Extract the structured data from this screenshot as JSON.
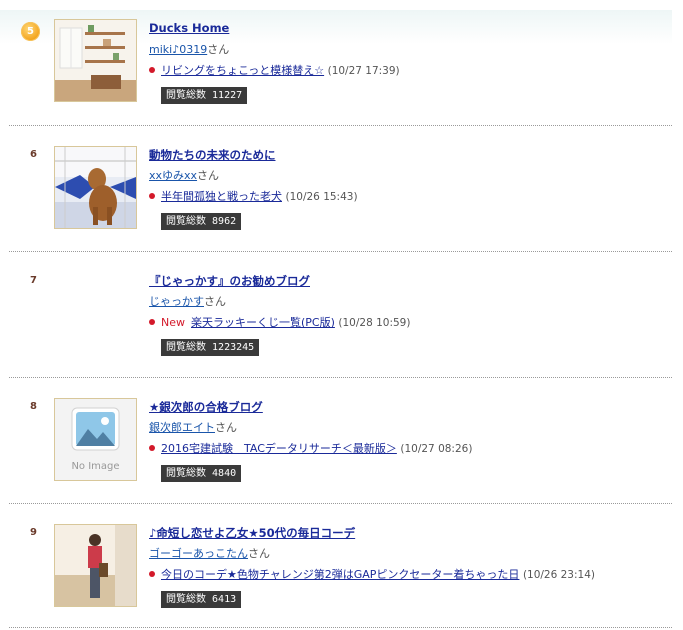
{
  "views_label": "閲覧総数",
  "entries": [
    {
      "rank": "5",
      "blog_title": "Ducks Home",
      "user": "miki♪0319",
      "san": "さん",
      "new_label": "",
      "post_title": "リビングをちょこっと模様替え☆",
      "date": "(10/27 17:39)",
      "views": "11227",
      "thumb": "room-photo"
    },
    {
      "rank": "6",
      "blog_title": "動物たちの未来のために",
      "user": "xxゆみxx",
      "san": "さん",
      "new_label": "",
      "post_title": "半年間孤独と戦った老犬",
      "date": "(10/26 15:43)",
      "views": "8962",
      "thumb": "dog-photo"
    },
    {
      "rank": "7",
      "blog_title": "『じゃっかす』のお勧めブログ",
      "user": "じゃっかす",
      "san": "さん",
      "new_label": "New",
      "post_title": "楽天ラッキーくじ一覧(PC版)",
      "date": "(10/28 10:59)",
      "views": "1223245",
      "thumb": ""
    },
    {
      "rank": "8",
      "blog_title": "★銀次郎の合格ブログ",
      "user": "銀次郎エイト",
      "san": "さん",
      "new_label": "",
      "post_title": "2016宅建試験　TACデータリサーチ＜最新版＞",
      "date": "(10/27 08:26)",
      "views": "4840",
      "thumb": "no-image",
      "no_image_text": "No Image"
    },
    {
      "rank": "9",
      "blog_title": "♪命短し恋せよ乙女★50代の毎日コーデ",
      "user": "ゴーゴーあっこたん",
      "san": "さん",
      "new_label": "",
      "post_title": "今日のコーデ★色物チャレンジ第2弾はGAPピンクセーター着ちゃった日",
      "date": "(10/26 23:14)",
      "views": "6413",
      "thumb": "fashion-photo"
    }
  ]
}
